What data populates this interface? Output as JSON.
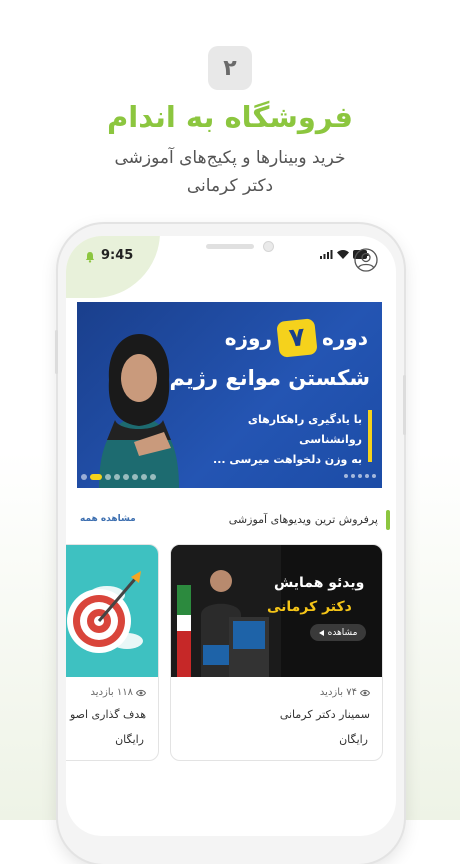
{
  "promo": {
    "step_number": "۲",
    "headline": "فروشگاه به اندام",
    "subtitle_line1": "خرید وبینارها و پکیج‌های آموزشی",
    "subtitle_line2": "دکتر کرمانی"
  },
  "status_bar": {
    "time": "9:45"
  },
  "banner": {
    "word_before": "دوره",
    "number": "۷",
    "word_after": "روزه",
    "main_title": "شکستن موانع رژیم",
    "body_line1": "با یادگیری راهکارهای روانشناسی",
    "body_line2": "به وزن دلخواهت میرسی ...",
    "slide_count": 8,
    "active_slide": 1
  },
  "section": {
    "title": "پرفروش ترین ویدیوهای آموزشی",
    "see_all": "مشاهده همه"
  },
  "cards": [
    {
      "thumb_line1": "ویدئو همایش",
      "thumb_line2": "دکتر کرمانی",
      "watch_label": "مشاهده",
      "views": "۷۴ بازدید",
      "title": "سمینار دکتر کرمانی",
      "price": "رایگان"
    },
    {
      "views": "۱۱۸ بازدید",
      "title": "هدف گذاری اصو",
      "price": "رایگان"
    }
  ],
  "colors": {
    "accent_green": "#8cc63f",
    "banner_blue": "#1f4ea6",
    "banner_yellow": "#f5d21c",
    "link_blue": "#3d6fb0"
  },
  "icons": [
    "bell-icon",
    "signal-icon",
    "wifi-icon",
    "battery-icon",
    "user-icon",
    "eye-icon",
    "play-icon",
    "target-icon"
  ]
}
